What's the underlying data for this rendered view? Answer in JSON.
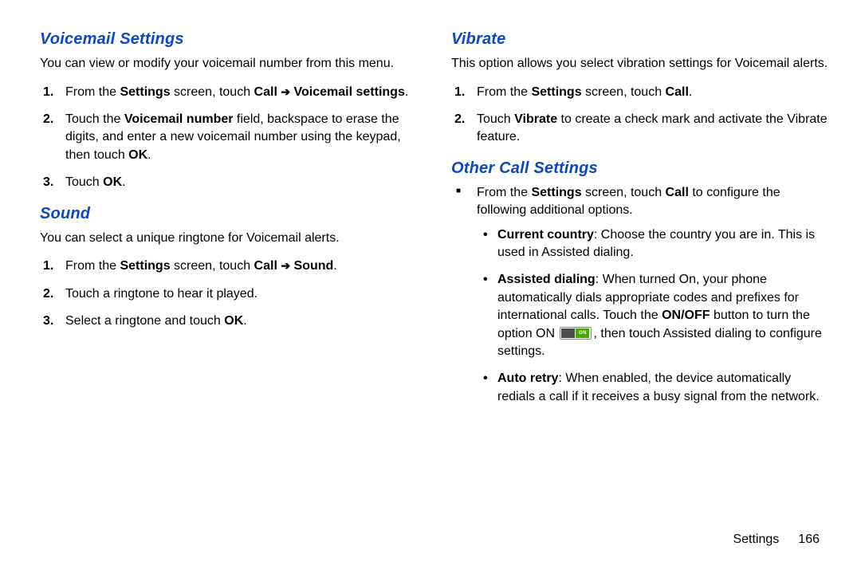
{
  "footer": {
    "label": "Settings",
    "page": "166"
  },
  "left": {
    "s1": {
      "heading": "Voicemail Settings",
      "intro": "You can view or modify your voicemail number from this menu.",
      "step1_a": "From the ",
      "step1_b": "Settings",
      "step1_c": " screen, touch ",
      "step1_d": "Call",
      "step1_e": "Voicemail settings",
      "step1_f": ".",
      "step2_a": "Touch the ",
      "step2_b": "Voicemail number",
      "step2_c": " field, backspace to erase the digits, and enter a new voicemail number using the keypad, then touch ",
      "step2_d": "OK",
      "step2_e": ".",
      "step3_a": "Touch ",
      "step3_b": "OK",
      "step3_c": "."
    },
    "s2": {
      "heading": "Sound",
      "intro": "You can select a unique ringtone for Voicemail alerts.",
      "step1_a": "From the ",
      "step1_b": "Settings",
      "step1_c": " screen, touch ",
      "step1_d": "Call",
      "step1_e": "Sound",
      "step1_f": ".",
      "step2": "Touch a ringtone to hear it played.",
      "step3_a": " Select a ringtone and touch ",
      "step3_b": "OK",
      "step3_c": "."
    }
  },
  "right": {
    "s1": {
      "heading": "Vibrate",
      "intro": "This option allows you select vibration settings for Voicemail alerts.",
      "step1_a": "From the ",
      "step1_b": "Settings",
      "step1_c": " screen, touch ",
      "step1_d": "Call",
      "step1_e": ".",
      "step2_a": "Touch ",
      "step2_b": "Vibrate",
      "step2_c": " to create a check mark and activate the Vibrate feature."
    },
    "s2": {
      "heading": "Other Call Settings",
      "top_a": "From the ",
      "top_b": "Settings",
      "top_c": " screen, touch ",
      "top_d": "Call",
      "top_e": " to configure the following additional options.",
      "b1_a": "Current country",
      "b1_b": ": Choose the country you are in. This is used in Assisted dialing.",
      "b2_a": "Assisted dialing",
      "b2_b": ": When turned On, your phone automatically dials appropriate codes and prefixes for international calls. Touch the ",
      "b2_c": "ON/OFF",
      "b2_d": " button to turn the option ON ",
      "b2_e": ", then touch Assisted dialing to configure settings.",
      "toggle_on": "ON",
      "b3_a": "Auto retry",
      "b3_b": ": When enabled, the device automatically redials a call if it receives a busy signal from the network."
    }
  }
}
